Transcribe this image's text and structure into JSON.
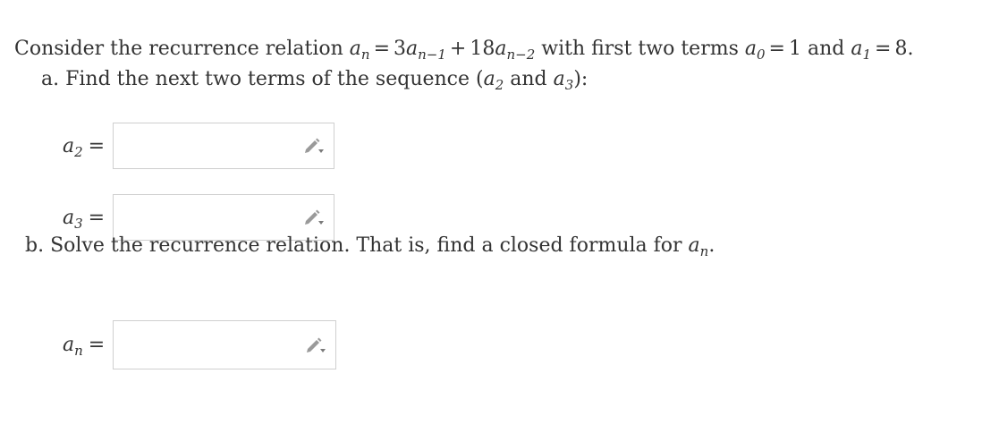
{
  "problem": {
    "intro_text_1": "Consider the recurrence relation ",
    "intro_lhs": "a",
    "intro_lhs_sub": "n",
    "intro_eq": "=",
    "intro_coef1": "3",
    "intro_var1": "a",
    "intro_var1_sub": "n−1",
    "intro_plus": "+",
    "intro_coef2": "18",
    "intro_var2": "a",
    "intro_var2_sub": "n−2",
    "intro_text_2": " with first two terms ",
    "a0_var": "a",
    "a0_sub": "0",
    "a0_eq": "=",
    "a0_val": "1",
    "and_text": " and ",
    "a1_var": "a",
    "a1_sub": "1",
    "a1_eq": "=",
    "a1_val": "8",
    "period": ".",
    "part_a_text": "a. Find the next two terms of the sequence (",
    "part_a_v1": "a",
    "part_a_v1_sub": "2",
    "part_a_and": " and ",
    "part_a_v2": "a",
    "part_a_v2_sub": "3",
    "part_a_end": "):",
    "part_b_text": "b. Solve the recurrence relation. That is, find a closed formula for ",
    "part_b_var": "a",
    "part_b_sub": "n",
    "part_b_end": "."
  },
  "answers": [
    {
      "var": "a",
      "sub": "2",
      "eq": "=",
      "value": "",
      "placeholder": ""
    },
    {
      "var": "a",
      "sub": "3",
      "eq": "=",
      "value": "",
      "placeholder": ""
    },
    {
      "var": "a",
      "sub": "n",
      "eq": "=",
      "value": "",
      "placeholder": ""
    }
  ],
  "icons": {
    "edit": "pencil-icon"
  },
  "colors": {
    "text": "#333333",
    "box_border": "#cfcfcf",
    "icon": "#999999"
  }
}
